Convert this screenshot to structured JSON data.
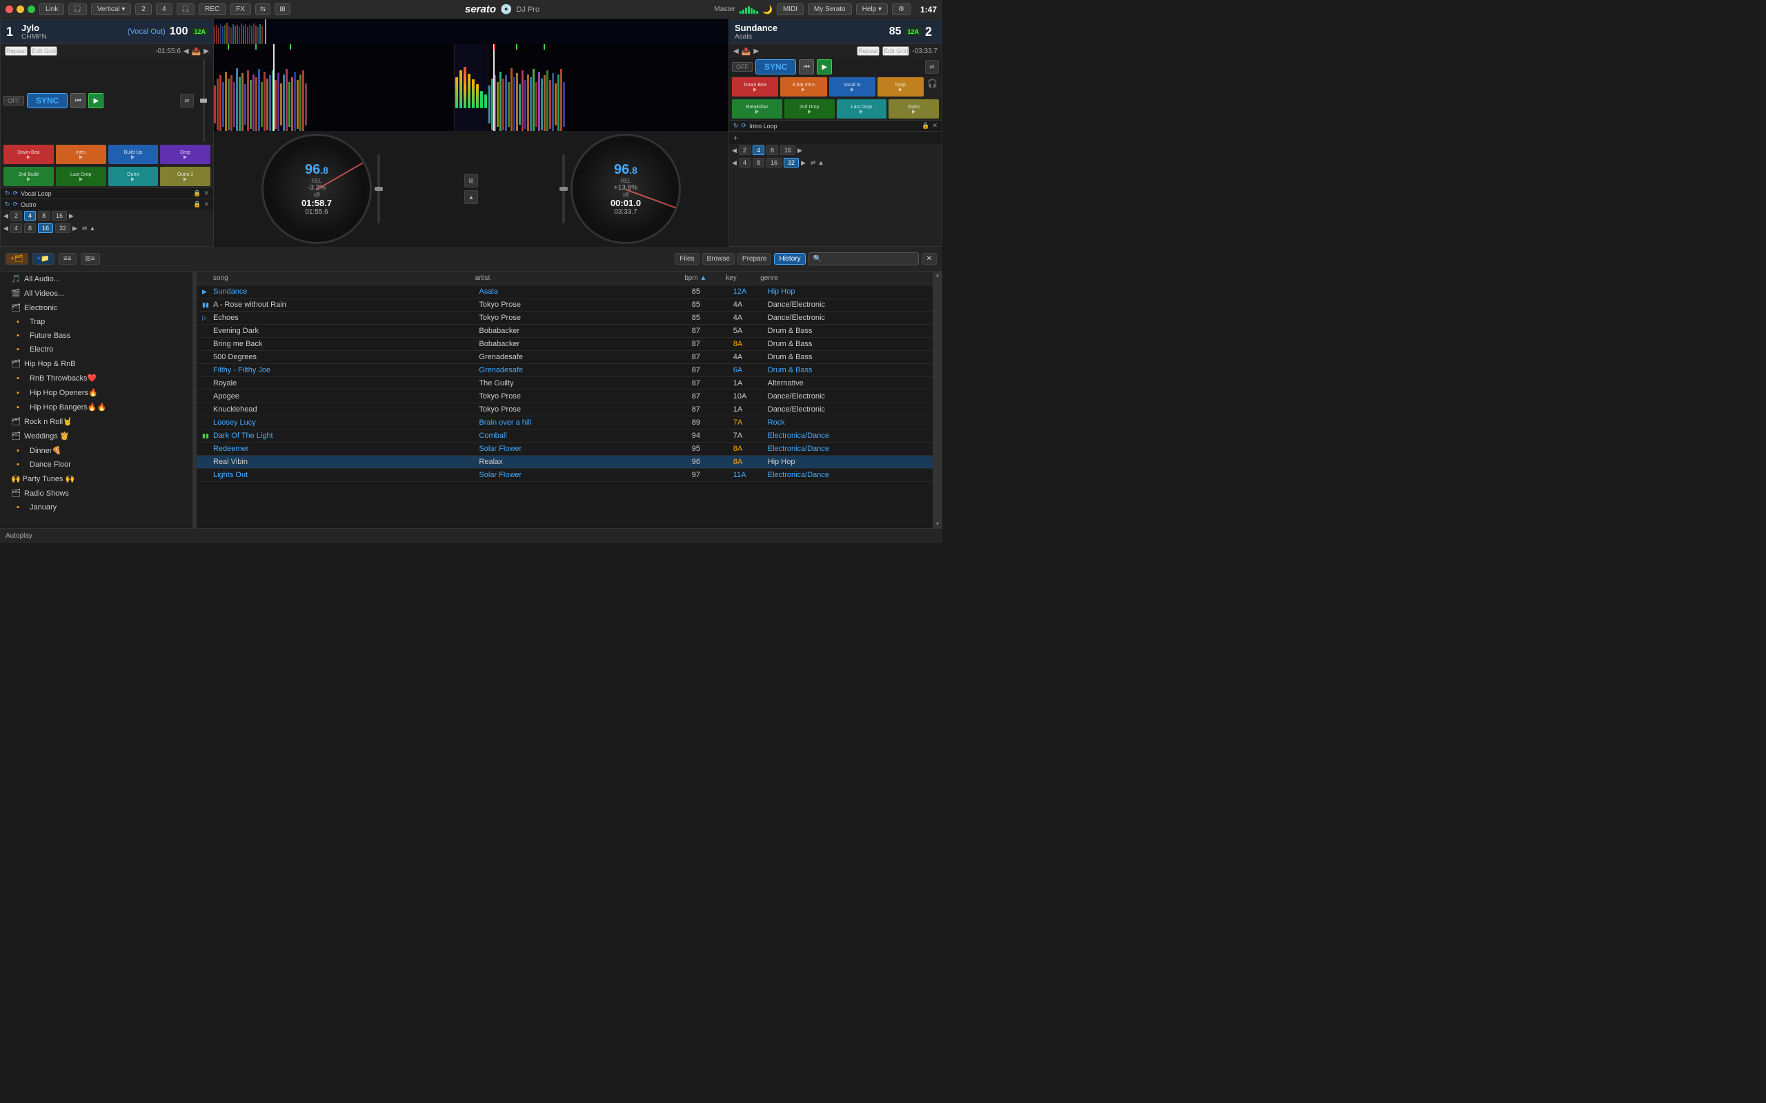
{
  "topbar": {
    "buttons": [
      "Link",
      "Vertical ▾",
      "2",
      "4",
      "REC",
      "FX",
      "MIDI",
      "My Serato",
      "Help ▾",
      "⚙"
    ],
    "serato_label": "serato",
    "djpro_label": "DJ Pro",
    "master_label": "Master",
    "time": "1:47"
  },
  "deck1": {
    "number": "1",
    "track_name": "Jylo",
    "artist": "CHMPN",
    "vocal_out": "(Vocal Out)",
    "bpm": "100",
    "key": "12A",
    "time_remaining": "-01:55:6",
    "repeat": "Repeat",
    "edit_grid": "Edit Grid",
    "hotcues": [
      {
        "label": "Down Bea",
        "color": "#c03030"
      },
      {
        "label": "Intro",
        "color": "#d06020"
      },
      {
        "label": "Build Up",
        "color": "#2060b0"
      },
      {
        "label": "Drop",
        "color": "#6030b0"
      }
    ],
    "hotcues2": [
      {
        "label": "2nd Build",
        "color": "#208030"
      },
      {
        "label": "Last Drop",
        "color": "#1a6a1a"
      },
      {
        "label": "Outro",
        "color": "#1a8a8a"
      },
      {
        "label": "Outro 2",
        "color": "#808030"
      }
    ],
    "loops": [
      {
        "name": "Vocal Loop",
        "active": true
      },
      {
        "name": "Outro",
        "active": false
      }
    ],
    "beat_row1": [
      "2",
      "4",
      "8",
      "16"
    ],
    "beat_row2": [
      "4",
      "8",
      "16",
      "32"
    ],
    "active_beat1": "4",
    "active_beat2": "16",
    "platter_bpm": "96",
    "platter_bpm_dec": ".8",
    "platter_rel": "REL",
    "platter_offset": "-3.2%",
    "platter_pm": "±8",
    "platter_time1": "01:58.7",
    "platter_time2": "01:55.6"
  },
  "deck2": {
    "number": "2",
    "track_name": "Sundance",
    "artist": "Asala",
    "bpm": "85",
    "key": "12A",
    "time_remaining": "-03:33:7",
    "repeat": "Repeat",
    "edit_grid": "Edit Grid",
    "hotcues": [
      {
        "label": "Down Bea",
        "color": "#c03030"
      },
      {
        "label": "8 bar Intro",
        "color": "#d06020"
      },
      {
        "label": "Vocal In",
        "color": "#2060b0"
      },
      {
        "label": "Drop",
        "color": "#6030b0"
      }
    ],
    "hotcues2": [
      {
        "label": "Breakdow",
        "color": "#208030"
      },
      {
        "label": "2nd Drop",
        "color": "#1a6a1a"
      },
      {
        "label": "Last Drop",
        "color": "#1a8a8a"
      },
      {
        "label": "Outro",
        "color": "#808030"
      }
    ],
    "loops": [
      {
        "name": "Intro Loop",
        "active": true
      }
    ],
    "beat_row1": [
      "2",
      "4",
      "8",
      "16"
    ],
    "beat_row2": [
      "4",
      "8",
      "16",
      "32"
    ],
    "active_beat1": "4",
    "active_beat2": "32",
    "platter_bpm": "96",
    "platter_bpm_dec": ".8",
    "platter_rel": "REL",
    "platter_offset": "+13.9%",
    "platter_pm": "±8",
    "platter_time1": "00:01.0",
    "platter_time2": "03:33.7"
  },
  "library": {
    "tabs": [
      "Files",
      "Browse",
      "Prepare",
      "History"
    ],
    "active_tab": "History",
    "search_placeholder": "🔍",
    "columns": {
      "song": "song",
      "artist": "artist",
      "bpm": "bpm",
      "key": "key",
      "genre": "genre"
    },
    "tracks": [
      {
        "song": "Sundance",
        "artist": "Asala",
        "bpm": "85",
        "key": "12A",
        "key_class": "k-cyan",
        "genre": "Hip Hop",
        "colored": true,
        "indicator": "▶",
        "ind_class": "loaded1"
      },
      {
        "song": "A - Rose without Rain",
        "artist": "Tokyo Prose",
        "bpm": "85",
        "key": "4A",
        "key_class": "",
        "genre": "Dance/Electronic",
        "colored": false,
        "indicator": "▮▮",
        "ind_class": "loaded1"
      },
      {
        "song": "Echoes",
        "artist": "Tokyo Prose",
        "bpm": "85",
        "key": "4A",
        "key_class": "",
        "genre": "Dance/Electronic",
        "colored": false,
        "indicator": "▷",
        "ind_class": ""
      },
      {
        "song": "Evening Dark",
        "artist": "Bobabacker",
        "bpm": "87",
        "key": "5A",
        "key_class": "",
        "genre": "Drum & Bass",
        "colored": false,
        "indicator": "",
        "ind_class": ""
      },
      {
        "song": "Bring me Back",
        "artist": "Bobabacker",
        "bpm": "87",
        "key": "8A",
        "key_class": "k-orange",
        "genre": "Drum & Bass",
        "colored": false,
        "indicator": "",
        "ind_class": ""
      },
      {
        "song": "500 Degrees",
        "artist": "Grenadesafe",
        "bpm": "87",
        "key": "4A",
        "key_class": "",
        "genre": "Drum & Bass",
        "colored": false,
        "indicator": "",
        "ind_class": ""
      },
      {
        "song": "Filthy - Filthy Joe",
        "artist": "Grenadesafe",
        "bpm": "87",
        "key": "6A",
        "key_class": "k-cyan",
        "genre": "Drum & Bass",
        "colored": true,
        "indicator": "",
        "ind_class": ""
      },
      {
        "song": "Royale",
        "artist": "The Guilty",
        "bpm": "87",
        "key": "1A",
        "key_class": "",
        "genre": "Alternative",
        "colored": false,
        "indicator": "",
        "ind_class": ""
      },
      {
        "song": "Apogee",
        "artist": "Tokyo Prose",
        "bpm": "87",
        "key": "10A",
        "key_class": "",
        "genre": "Dance/Electronic",
        "colored": false,
        "indicator": "",
        "ind_class": ""
      },
      {
        "song": "Knucklehead",
        "artist": "Tokyo Prose",
        "bpm": "87",
        "key": "1A",
        "key_class": "",
        "genre": "Dance/Electronic",
        "colored": false,
        "indicator": "",
        "ind_class": ""
      },
      {
        "song": "Loosey Lucy",
        "artist": "Brain over a hill",
        "bpm": "89",
        "key": "7A",
        "key_class": "k-orange",
        "genre": "Rock",
        "colored": true,
        "indicator": "",
        "ind_class": ""
      },
      {
        "song": "Dark Of The Light",
        "artist": "Comball",
        "bpm": "94",
        "key": "7A",
        "key_class": "",
        "genre": "Electronica/Dance",
        "colored": true,
        "indicator": "▮▮",
        "ind_class": "loaded2"
      },
      {
        "song": "Redeemer",
        "artist": "Solar Flower",
        "bpm": "95",
        "key": "8A",
        "key_class": "k-orange",
        "genre": "Electronica/Dance",
        "colored": true,
        "indicator": "",
        "ind_class": ""
      },
      {
        "song": "Real Vibin",
        "artist": "Realax",
        "bpm": "96",
        "key": "8A",
        "key_class": "k-orange",
        "genre": "Hip Hop",
        "colored": false,
        "indicator": "",
        "ind_class": "",
        "highlighted": true
      },
      {
        "song": "Lights Out",
        "artist": "Solar Flower",
        "bpm": "97",
        "key": "11A",
        "key_class": "k-cyan",
        "genre": "Electronica/Dance",
        "colored": true,
        "indicator": "",
        "ind_class": ""
      }
    ],
    "sidebar": {
      "items": [
        {
          "label": "All Audio...",
          "icon": "🎵",
          "indent": 0,
          "type": "item"
        },
        {
          "label": "All Videos...",
          "icon": "🎬",
          "indent": 0,
          "type": "item"
        },
        {
          "label": "Electronic",
          "icon": "▼",
          "indent": 0,
          "type": "folder"
        },
        {
          "label": "Trap",
          "icon": "🟧",
          "indent": 1,
          "type": "item"
        },
        {
          "label": "Future Bass",
          "icon": "🟧",
          "indent": 1,
          "type": "item"
        },
        {
          "label": "Electro",
          "icon": "🟧",
          "indent": 1,
          "type": "item"
        },
        {
          "label": "Hip Hop & RnB",
          "icon": "▼",
          "indent": 0,
          "type": "folder"
        },
        {
          "label": "RnB Throwbacks❤️",
          "icon": "🟧",
          "indent": 1,
          "type": "item"
        },
        {
          "label": "Hip Hop Openers🔥",
          "icon": "🟧",
          "indent": 1,
          "type": "item"
        },
        {
          "label": "Hip Hop Bangers🔥🔥",
          "icon": "🟧",
          "indent": 1,
          "type": "item"
        },
        {
          "label": "Rock n Roll🤘",
          "icon": "▼",
          "indent": 0,
          "type": "folder"
        },
        {
          "label": "Weddings 👸",
          "icon": "▼",
          "indent": 0,
          "type": "folder"
        },
        {
          "label": "Dinner🍕",
          "icon": "🟧",
          "indent": 1,
          "type": "item"
        },
        {
          "label": "Dance Floor",
          "icon": "🟧",
          "indent": 1,
          "type": "item"
        },
        {
          "label": "🙌 Party Tunes 🙌",
          "icon": "...",
          "indent": 0,
          "type": "item"
        },
        {
          "label": "Radio Shows",
          "icon": "▼",
          "indent": 0,
          "type": "folder"
        },
        {
          "label": "January",
          "icon": "🟧",
          "indent": 1,
          "type": "item"
        }
      ]
    }
  },
  "autoplay": "Autoplay"
}
